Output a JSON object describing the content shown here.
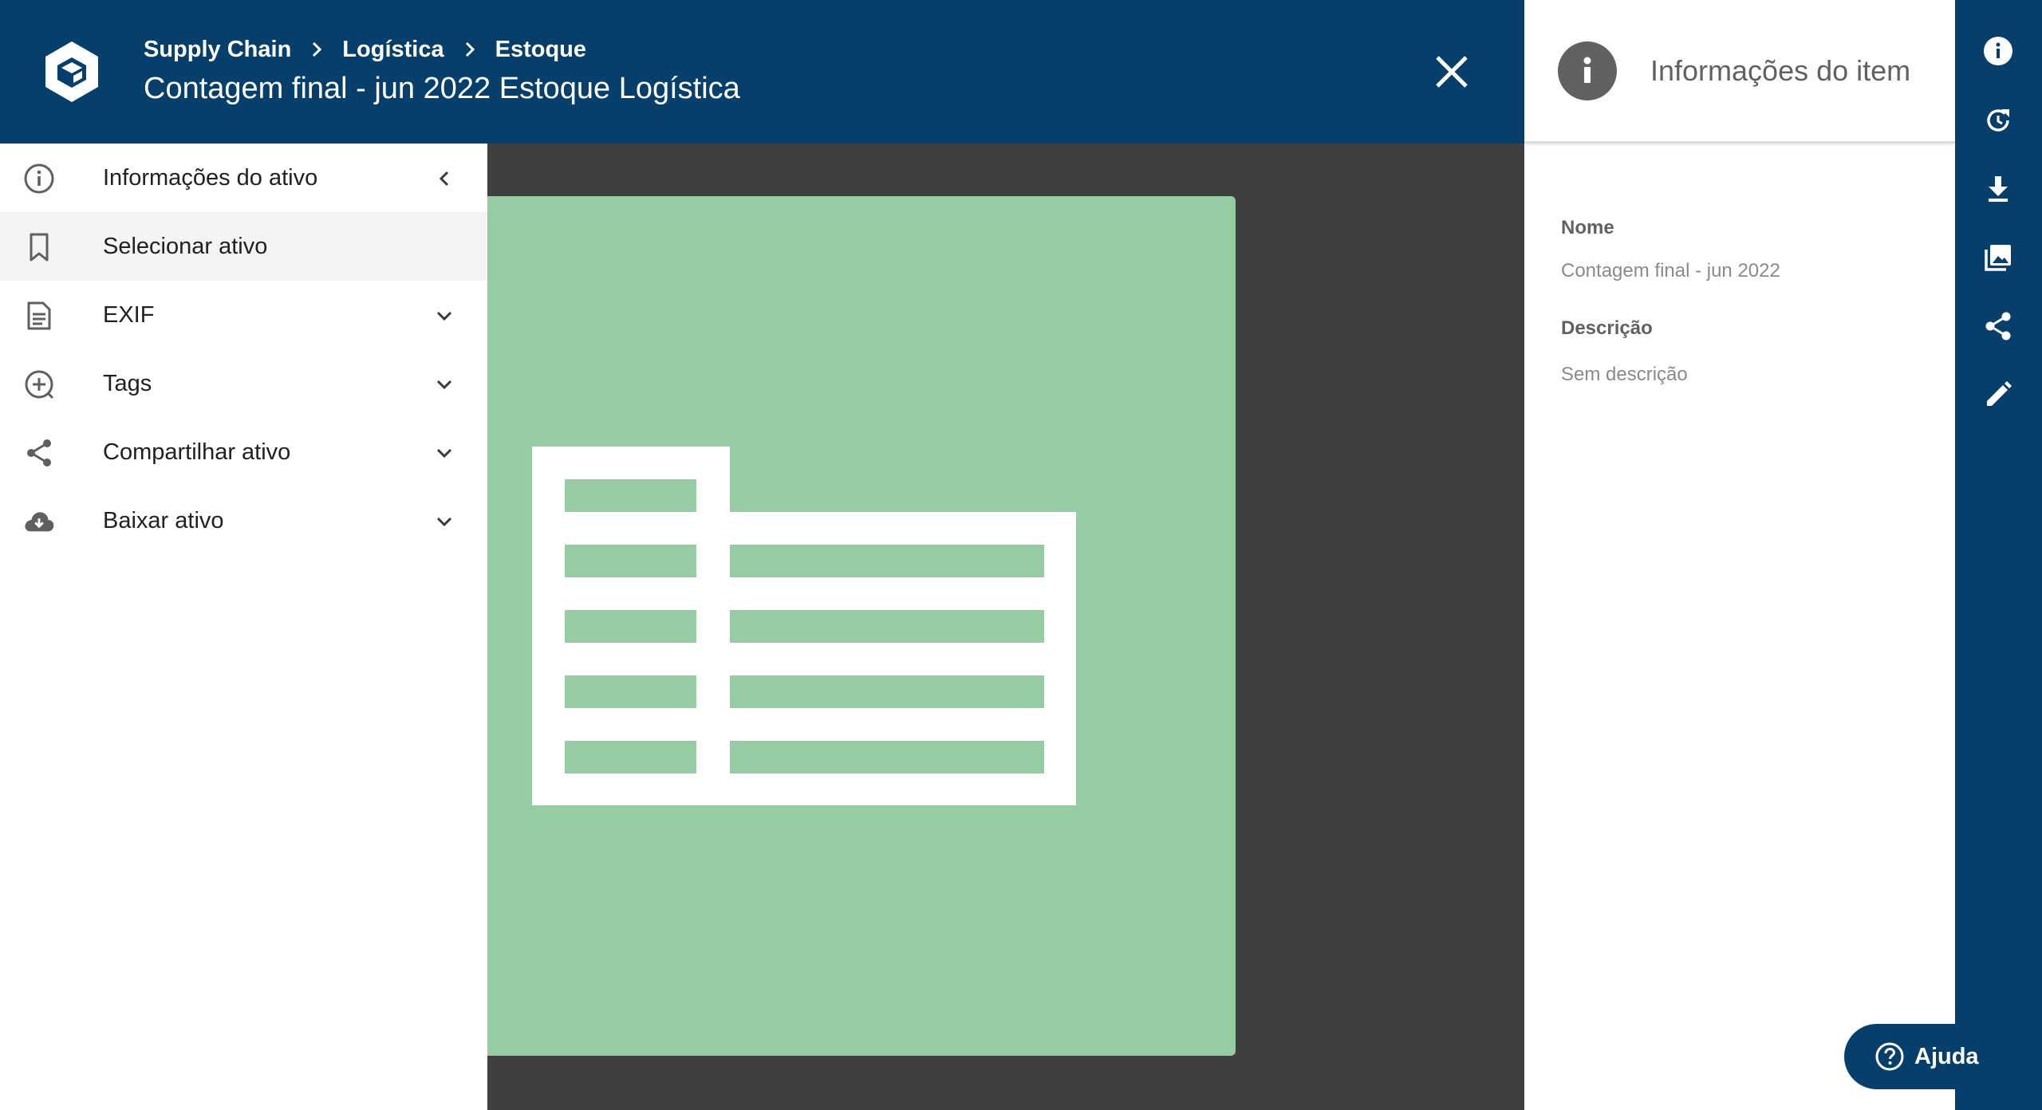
{
  "header": {
    "breadcrumb": [
      "Supply Chain",
      "Logística",
      "Estoque"
    ],
    "title": "Contagem final - jun 2022 Estoque Logística",
    "close_icon": "close-icon",
    "logo_icon": "hexagon-logo-icon"
  },
  "sidebar": {
    "items": [
      {
        "label": "Informações do ativo",
        "icon": "info-outline-icon",
        "chevron": "chevron-left-icon"
      },
      {
        "label": "Selecionar ativo",
        "icon": "bookmark-icon",
        "selected": true
      },
      {
        "label": "EXIF",
        "icon": "document-icon",
        "chevron": "chevron-down-icon"
      },
      {
        "label": "Tags",
        "icon": "add-circle-icon",
        "chevron": "chevron-down-icon"
      },
      {
        "label": "Compartilhar ativo",
        "icon": "share-icon",
        "chevron": "chevron-down-icon"
      },
      {
        "label": "Baixar ativo",
        "icon": "cloud-download-icon",
        "chevron": "chevron-down-icon"
      }
    ]
  },
  "preview": {
    "icon": "spreadsheet-icon",
    "background_color": "#95cca3"
  },
  "info_panel": {
    "title": "Informações do item",
    "fields": [
      {
        "label": "Nome",
        "value": "Contagem final - jun 2022"
      },
      {
        "label": "Descrição",
        "value": "Sem descrição"
      }
    ]
  },
  "rail": {
    "icons": [
      "info-icon",
      "history-icon",
      "download-icon",
      "image-icon",
      "share-icon",
      "edit-icon"
    ]
  },
  "help": {
    "label": "Ajuda",
    "icon": "help-circle-icon"
  },
  "colors": {
    "primary": "#063f6b",
    "viewer_bg": "#3f3f3f",
    "preview_bg": "#95cca3",
    "selected_bg": "#f4f4f4"
  }
}
